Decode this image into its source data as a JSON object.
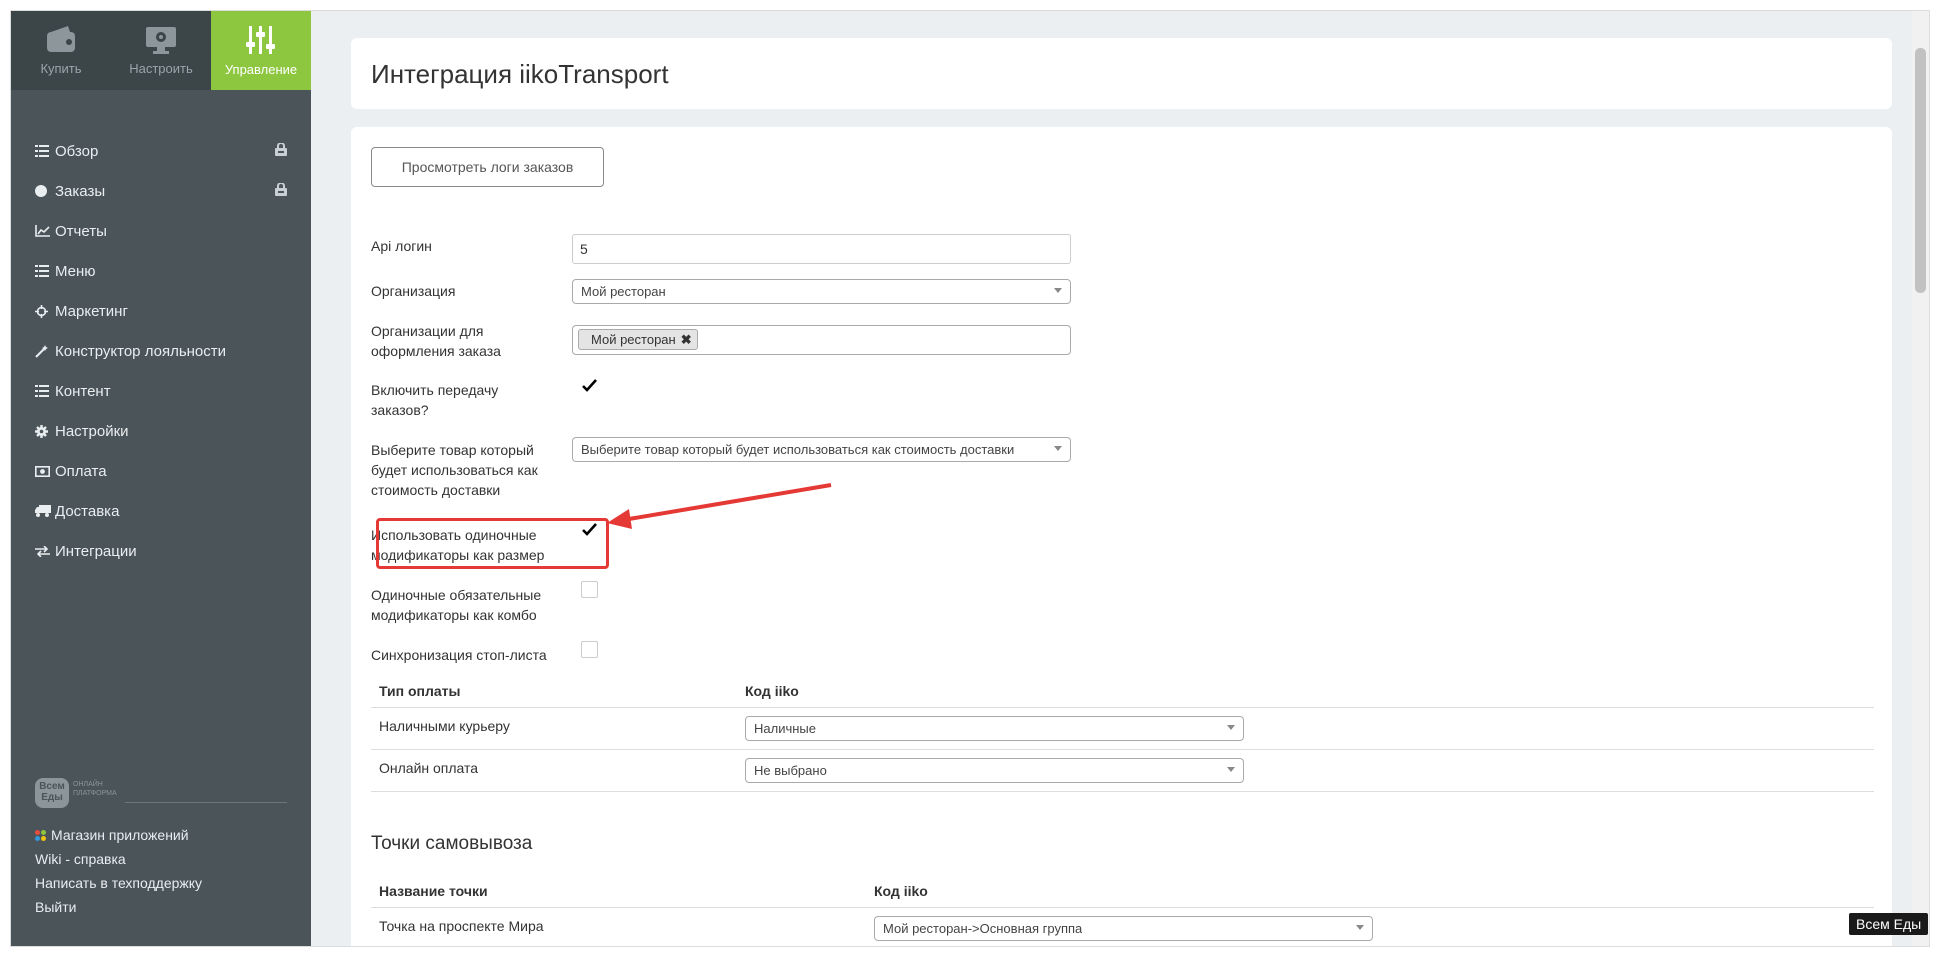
{
  "topnav": [
    {
      "label": "Купить",
      "icon": "wallet-icon"
    },
    {
      "label": "Настроить",
      "icon": "monitor-gear-icon"
    },
    {
      "label": "Управление",
      "icon": "sliders-icon",
      "active": true
    }
  ],
  "sidebar": {
    "items": [
      {
        "label": "Обзор",
        "icon": "list-icon",
        "lock": true
      },
      {
        "label": "Заказы",
        "icon": "circle-icon",
        "lock": true
      },
      {
        "label": "Отчеты",
        "icon": "line-chart-icon"
      },
      {
        "label": "Меню",
        "icon": "list-icon"
      },
      {
        "label": "Маркетинг",
        "icon": "crosshair-icon"
      },
      {
        "label": "Конструктор лояльности",
        "icon": "magic-wand-icon"
      },
      {
        "label": "Контент",
        "icon": "list-icon"
      },
      {
        "label": "Настройки",
        "icon": "gear-icon"
      },
      {
        "label": "Оплата",
        "icon": "money-icon"
      },
      {
        "label": "Доставка",
        "icon": "truck-icon"
      },
      {
        "label": "Интеграции",
        "icon": "exchange-icon"
      }
    ],
    "brand": {
      "logo": "Всем Еды",
      "sub1": "ОНЛАЙН",
      "sub2": "ПЛАТФОРМА"
    },
    "footer": [
      {
        "label": "Магазин приложений"
      },
      {
        "label": "Wiki - справка"
      },
      {
        "label": "Написать в техподдержку"
      },
      {
        "label": "Выйти"
      }
    ]
  },
  "page": {
    "title": "Интеграция iikoTransport",
    "logs_button": "Просмотреть логи заказов"
  },
  "form": {
    "api_login": {
      "label": "Api логин",
      "value": "5"
    },
    "organization": {
      "label": "Организация",
      "value": "Мой ресторан"
    },
    "order_orgs": {
      "label_1": "Организации для",
      "label_2": "оформления заказа",
      "tag": "Мой ресторан"
    },
    "enable_transfer": {
      "label_1": "Включить передачу",
      "label_2": "заказов?",
      "checked": true
    },
    "delivery_product": {
      "label_1": "Выберите товар который",
      "label_2": "будет использоваться как",
      "label_3": "стоимость доставки",
      "value": "Выберите товар который будет использоваться как стоимость доставки"
    },
    "single_modifiers": {
      "label_1": "Использовать одиночные",
      "label_2": "модификаторы как размер",
      "checked": true
    },
    "combo_modifiers": {
      "label_1": "Одиночные обязательные",
      "label_2": "модификаторы как комбо",
      "checked": false
    },
    "stop_list": {
      "label": "Синхронизация стоп-листа",
      "checked": false
    }
  },
  "payments": {
    "headers": [
      "Тип оплаты",
      "Код iiko"
    ],
    "rows": [
      {
        "type": "Наличными курьеру",
        "code": "Наличные"
      },
      {
        "type": "Онлайн оплата",
        "code": "Не выбрано"
      }
    ]
  },
  "pickup": {
    "title": "Точки самовывоза",
    "headers": [
      "Название точки",
      "Код iiko"
    ],
    "rows": [
      {
        "name": "Точка на проспекте Мира",
        "code": "Мой ресторан->Основная группа"
      }
    ]
  },
  "badge": "Всем Еды",
  "colors": {
    "sidebar": "#4a5459",
    "topnav": "#3c4548",
    "accent": "#8dc63f",
    "highlight": "#e53935"
  }
}
